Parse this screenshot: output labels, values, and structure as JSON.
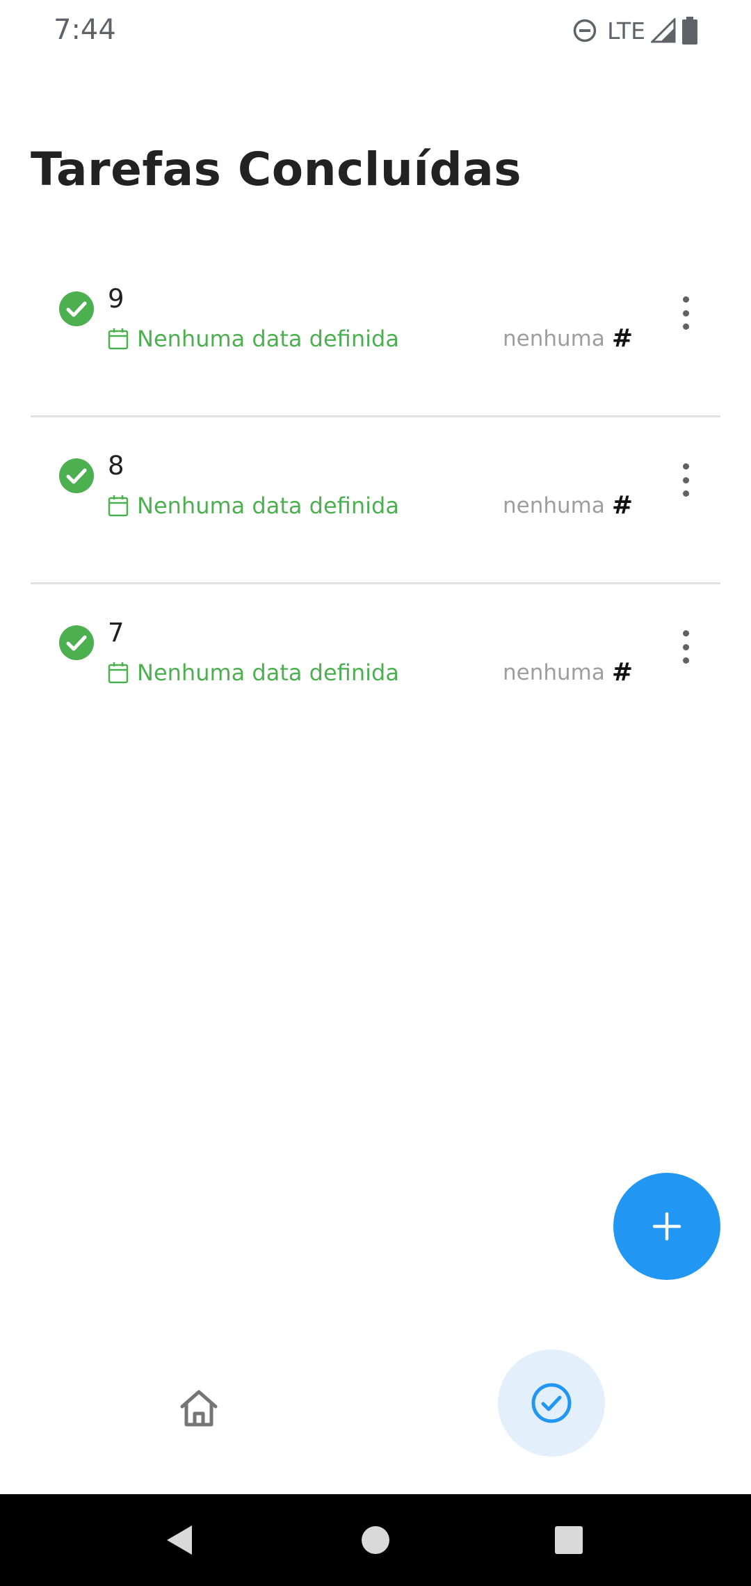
{
  "status_bar": {
    "time": "7:44",
    "network": "LTE"
  },
  "page": {
    "title": "Tarefas Concluídas"
  },
  "tasks": [
    {
      "title": "9",
      "date": "Nenhuma data definida",
      "category": "nenhuma",
      "completed": true
    },
    {
      "title": "8",
      "date": "Nenhuma data definida",
      "category": "nenhuma",
      "completed": true
    },
    {
      "title": "7",
      "date": "Nenhuma data definida",
      "category": "nenhuma",
      "completed": true
    }
  ],
  "icons": {
    "check": "check-circle-icon",
    "calendar": "calendar-icon",
    "category": "hash-icon",
    "more": "more-vertical-icon",
    "fab": "plus-icon",
    "nav_home": "home-icon",
    "nav_completed": "check-circle-outline-icon"
  },
  "colors": {
    "accent": "#2196f3",
    "success": "#4caf50",
    "nav_active_bg": "#e3f0fc",
    "title": "#222222",
    "muted": "#9e9e9e"
  },
  "bottom_nav": {
    "active": "completed"
  }
}
